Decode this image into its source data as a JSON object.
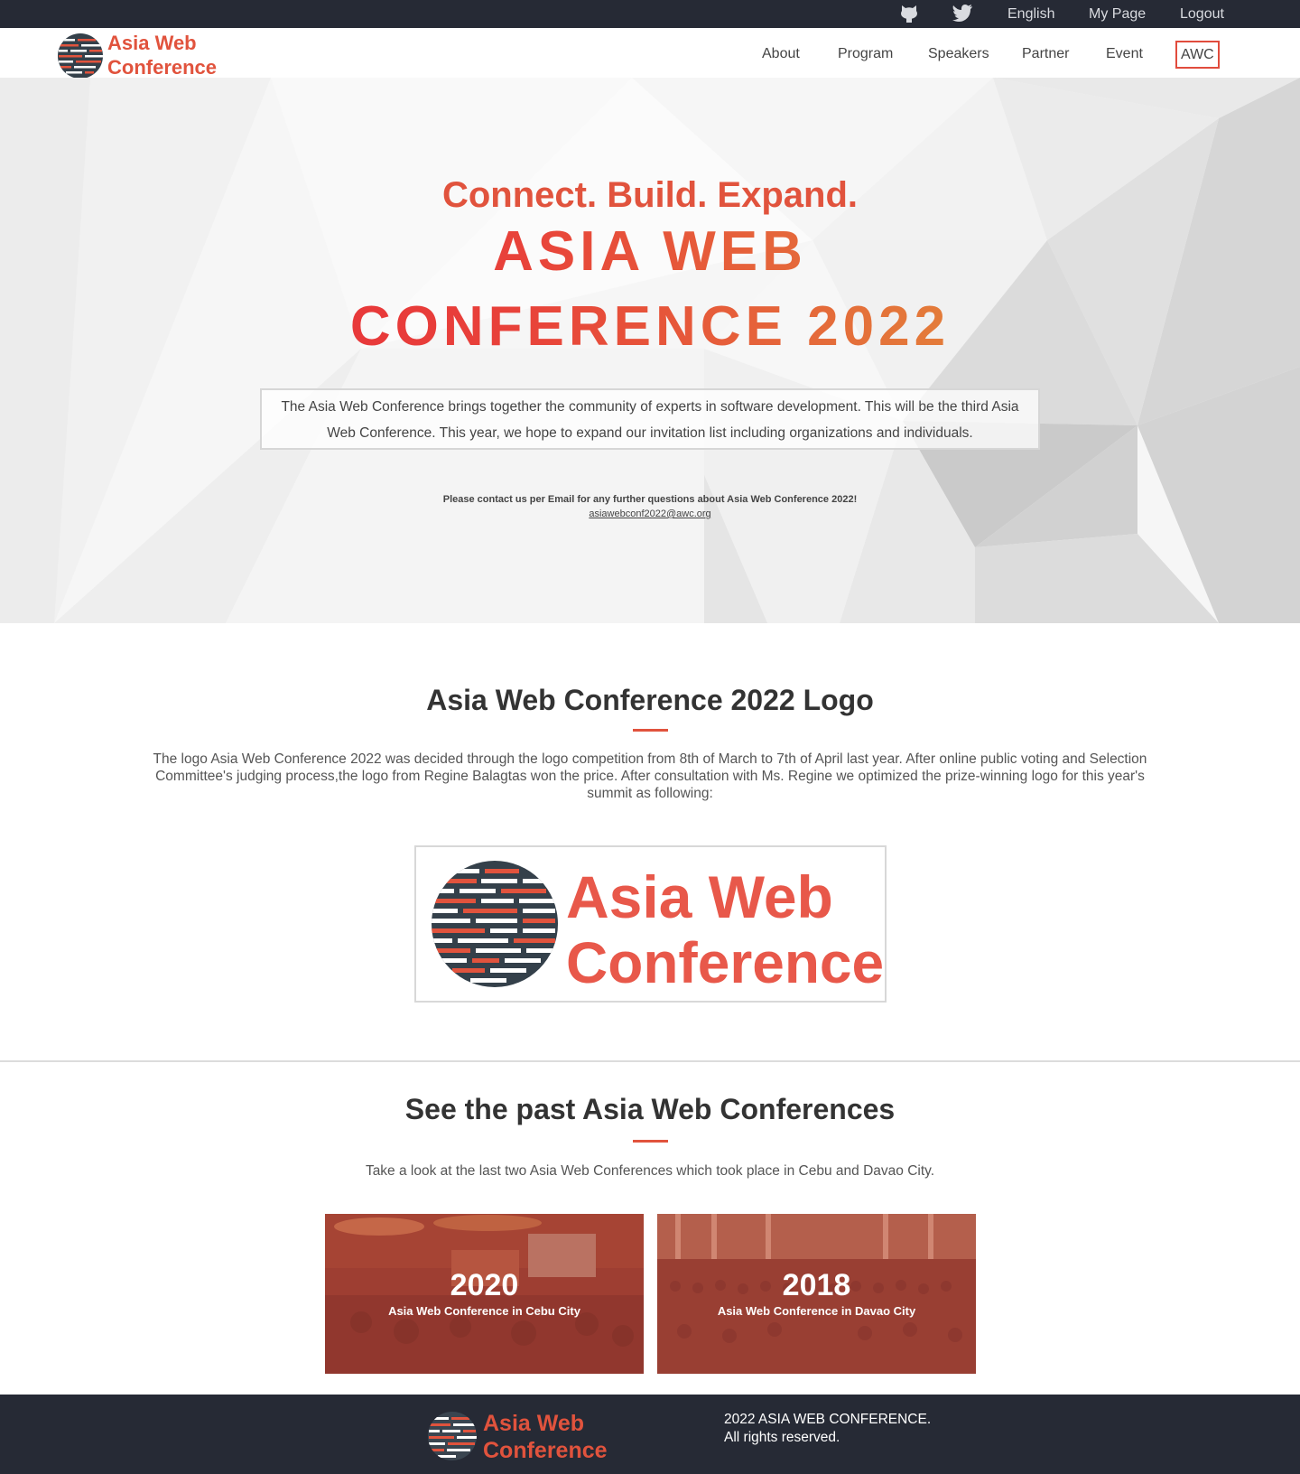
{
  "topbar": {
    "icons": [
      "github-icon",
      "twitter-icon"
    ],
    "language": "English",
    "my_page": "My Page",
    "logout": "Logout"
  },
  "nav": {
    "logo_text_line1": "Asia Web",
    "logo_text_line2": "Conference",
    "links": [
      "About",
      "Program",
      "Speakers",
      "Partner",
      "Event",
      "AWC"
    ]
  },
  "hero": {
    "tagline": "Connect. Build. Expand.",
    "title_line1": "ASIA WEB",
    "title_line2": "CONFERENCE 2022",
    "intro": "The Asia Web Conference brings together the community of experts in software development. This will be the third Asia Web Conference. This year, we hope to expand our invitation list including organizations and individuals.",
    "contact": "Please contact us per Email for any further questions about Asia Web Conference 2022!",
    "email": "asiawebconf2022@awc.org"
  },
  "logo_section": {
    "title": "Asia Web Conference 2022 Logo",
    "text": "The logo Asia Web Conference 2022 was decided through the logo competition from 8th of March to 7th of April last year. After online public voting and Selection Committee's judging process,the logo from Regine Balagtas won the price. After consultation with Ms. Regine we optimized the prize-winning logo for this year's summit as following:",
    "logo_line1": "Asia Web",
    "logo_line2": "Conference"
  },
  "past_section": {
    "title": "See the past Asia Web Conferences",
    "text": "Take a look at the last two Asia Web Conferences which took place in Cebu and Davao City.",
    "cards": [
      {
        "year": "2020",
        "subtitle": "Asia Web Conference in Cebu City"
      },
      {
        "year": "2018",
        "subtitle": "Asia Web Conference in Davao City"
      }
    ]
  },
  "footer": {
    "logo_line1": "Asia Web",
    "logo_line2": "Conference",
    "copyright_line1": "2022 ASIA WEB CONFERENCE.",
    "copyright_line2": "All rights reserved."
  },
  "colors": {
    "accent": "#e1533d",
    "dark": "#262a35",
    "logo_circle": "#34404a"
  }
}
